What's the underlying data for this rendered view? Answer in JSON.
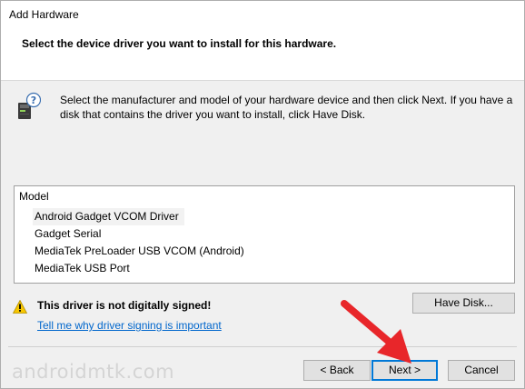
{
  "window": {
    "title": "Add Hardware",
    "heading": "Select the device driver you want to install for this hardware."
  },
  "instructions": {
    "icon": "hardware-help-icon",
    "text": "Select the manufacturer and model of your hardware device and then click Next. If you have a disk that contains the driver you want to install, click Have Disk."
  },
  "model_list": {
    "header": "Model",
    "items": [
      {
        "label": "Android Gadget VCOM Driver",
        "selected": true
      },
      {
        "label": "Gadget Serial",
        "selected": false
      },
      {
        "label": "MediaTek PreLoader USB VCOM (Android)",
        "selected": false
      },
      {
        "label": "MediaTek USB Port",
        "selected": false
      }
    ]
  },
  "warning": {
    "icon": "warning-icon",
    "text": "This driver is not digitally signed!",
    "link": "Tell me why driver signing is important"
  },
  "buttons": {
    "have_disk": "Have Disk...",
    "back": "< Back",
    "next": "Next >",
    "cancel": "Cancel"
  },
  "watermark": "androidmtk.com",
  "annotation": {
    "arrow_color": "#e8262a",
    "points_to": "next-button"
  },
  "colors": {
    "link": "#0066cc",
    "default_button_border": "#0078d7",
    "warning_yellow": "#f7c600"
  }
}
